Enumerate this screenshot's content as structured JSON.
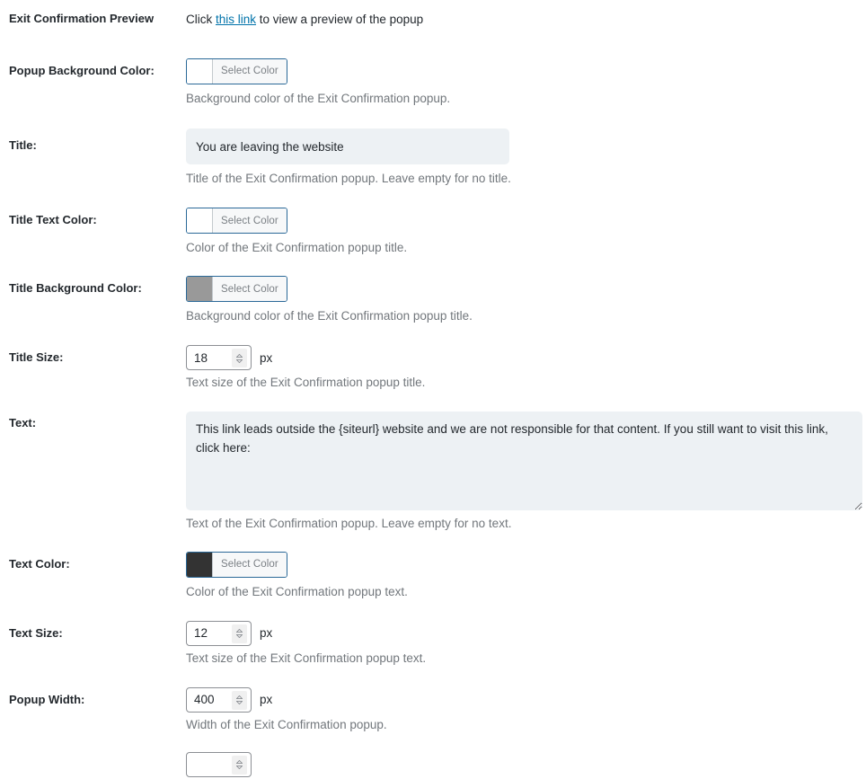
{
  "colors": {
    "link": "#0073aa",
    "label": "#23282d",
    "description": "#72777c",
    "input_bg": "#edf1f4",
    "picker_border": "#2b6998",
    "swatch_popup_bg": "#ffffff",
    "swatch_title_text": "#ffffff",
    "swatch_title_bg": "#999999",
    "swatch_text": "#333333"
  },
  "rows": {
    "preview": {
      "label": "Exit Confirmation Preview",
      "text_before": "Click ",
      "link": "this link",
      "text_after": " to view a preview of the popup"
    },
    "popup_bg_color": {
      "label": "Popup Background Color:",
      "button": "Select Color",
      "swatch": "#ffffff",
      "description": "Background color of the Exit Confirmation popup."
    },
    "title": {
      "label": "Title:",
      "value": "You are leaving the website",
      "description": "Title of the Exit Confirmation popup. Leave empty for no title."
    },
    "title_text_color": {
      "label": "Title Text Color:",
      "button": "Select Color",
      "swatch": "#ffffff",
      "description": "Color of the Exit Confirmation popup title."
    },
    "title_bg_color": {
      "label": "Title Background Color:",
      "button": "Select Color",
      "swatch": "#999999",
      "description": "Background color of the Exit Confirmation popup title."
    },
    "title_size": {
      "label": "Title Size:",
      "value": "18",
      "unit": "px",
      "description": "Text size of the Exit Confirmation popup title."
    },
    "text": {
      "label": "Text:",
      "value": "This link leads outside the {siteurl} website and we are not responsible for that content. If you still want to visit this link, click here:",
      "description": "Text of the Exit Confirmation popup. Leave empty for no text."
    },
    "text_color": {
      "label": "Text Color:",
      "button": "Select Color",
      "swatch": "#333333",
      "description": "Color of the Exit Confirmation popup text."
    },
    "text_size": {
      "label": "Text Size:",
      "value": "12",
      "unit": "px",
      "description": "Text size of the Exit Confirmation popup text."
    },
    "popup_width": {
      "label": "Popup Width:",
      "value": "400",
      "unit": "px",
      "description": "Width of the Exit Confirmation popup."
    }
  }
}
